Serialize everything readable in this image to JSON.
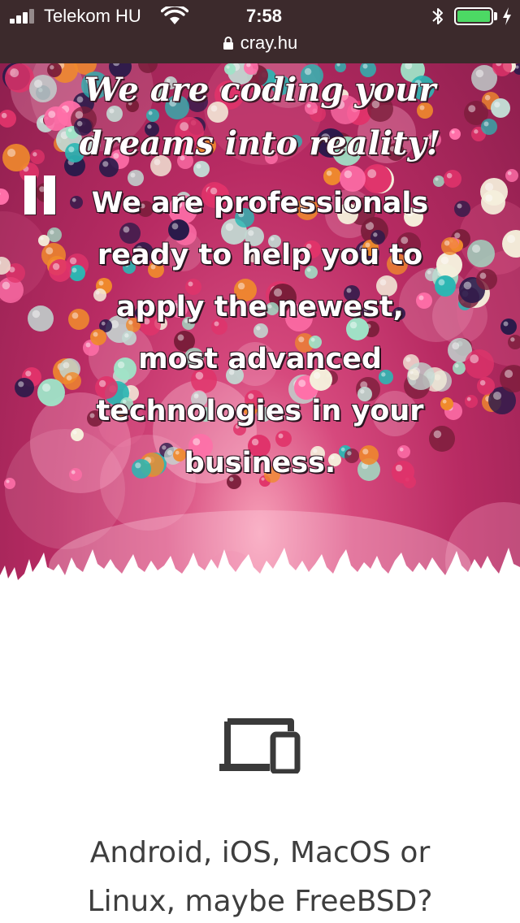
{
  "status_bar": {
    "carrier": "Telekom HU",
    "time": "7:58",
    "url": "cray.hu",
    "battery_level": 1.0,
    "battery_color": "#4cd964",
    "icons": [
      "signal-icon",
      "wifi-icon",
      "bluetooth-icon",
      "battery-icon",
      "charging-icon",
      "lock-icon"
    ]
  },
  "hero": {
    "title_lines": [
      "We are coding your",
      "dreams into reality!"
    ],
    "text_lines": [
      "We are professionals",
      "ready to help you to",
      "apply the newest,",
      "most advanced",
      "technologies in your",
      "business."
    ],
    "pause_icon": "pause-icon",
    "accent": "#c2336c"
  },
  "section": {
    "icon": "devices-icon",
    "text_lines": [
      "Android, iOS, MacOS or",
      "Linux, maybe FreeBSD?"
    ]
  }
}
